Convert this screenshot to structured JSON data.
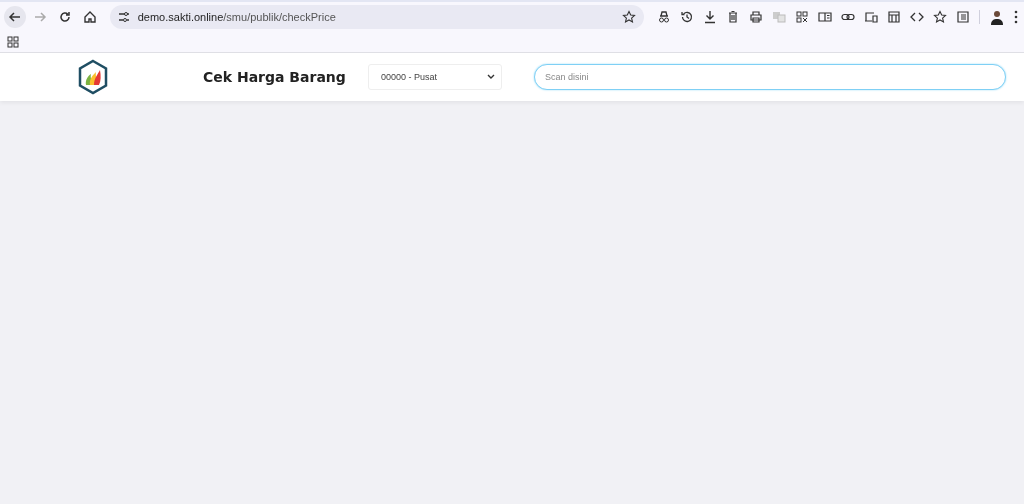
{
  "browser": {
    "url_host": "demo.sakti.online",
    "url_path": "/smu/publik/checkPrice"
  },
  "header": {
    "title": "Cek Harga Barang",
    "branch": "00000 - Pusat",
    "search": {
      "placeholder": "Scan disini",
      "focused": true
    }
  }
}
